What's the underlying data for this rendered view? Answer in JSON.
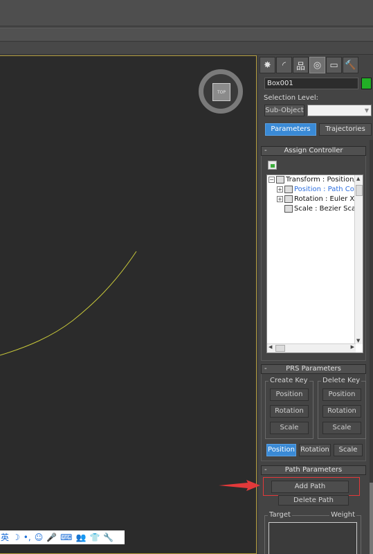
{
  "viewport": {
    "viewcube_label": "TOP"
  },
  "command_panel": {
    "tabs": [
      {
        "name": "create-tab-icon",
        "glyph": "✸"
      },
      {
        "name": "modify-tab-icon",
        "glyph": "◜"
      },
      {
        "name": "hierarchy-tab-icon",
        "glyph": "品"
      },
      {
        "name": "motion-tab-icon",
        "glyph": "◎"
      },
      {
        "name": "display-tab-icon",
        "glyph": "▭"
      },
      {
        "name": "utilities-tab-icon",
        "glyph": "🔨"
      }
    ],
    "object_name": "Box001",
    "object_color": "#22b026",
    "selection_level_label": "Selection Level:",
    "sub_object_label": "Sub-Object",
    "parameters_label": "Parameters",
    "trajectories_label": "Trajectories",
    "assign_controller": {
      "header": "Assign Controller",
      "minus": "-",
      "tree": [
        {
          "label": "Transform : Position/",
          "expander": "⊖",
          "selected": false
        },
        {
          "label": "Position : Path Co",
          "expander": "⊕",
          "selected": true
        },
        {
          "label": "Rotation : Euler X",
          "expander": "⊕",
          "selected": false
        },
        {
          "label": "Scale : Bezier Sca",
          "expander": "",
          "selected": false
        }
      ]
    },
    "prs_parameters": {
      "header": "PRS Parameters",
      "minus": "-",
      "create_key_label": "Create Key",
      "delete_key_label": "Delete Key",
      "create_buttons": [
        "Position",
        "Rotation",
        "Scale"
      ],
      "delete_buttons": [
        "Position",
        "Rotation",
        "Scale"
      ],
      "mode_buttons": [
        "Position",
        "Rotation",
        "Scale"
      ],
      "active_mode": "Position"
    },
    "path_parameters": {
      "header": "Path Parameters",
      "minus": "-",
      "add_path_label": "Add Path",
      "delete_path_label": "Delete Path",
      "target_label": "Target",
      "weight_label": "Weight"
    }
  },
  "ime_toolbar": {
    "items": [
      "英",
      "☽",
      "•,",
      "☺",
      "🎤",
      "⌨",
      "👥",
      "👕",
      "🔧"
    ]
  },
  "accent_colors": {
    "viewport_border": "#b29a3a",
    "path_curve": "#c8c83a",
    "active_button": "#3a8ad6",
    "annotation_red": "#e2393a"
  }
}
